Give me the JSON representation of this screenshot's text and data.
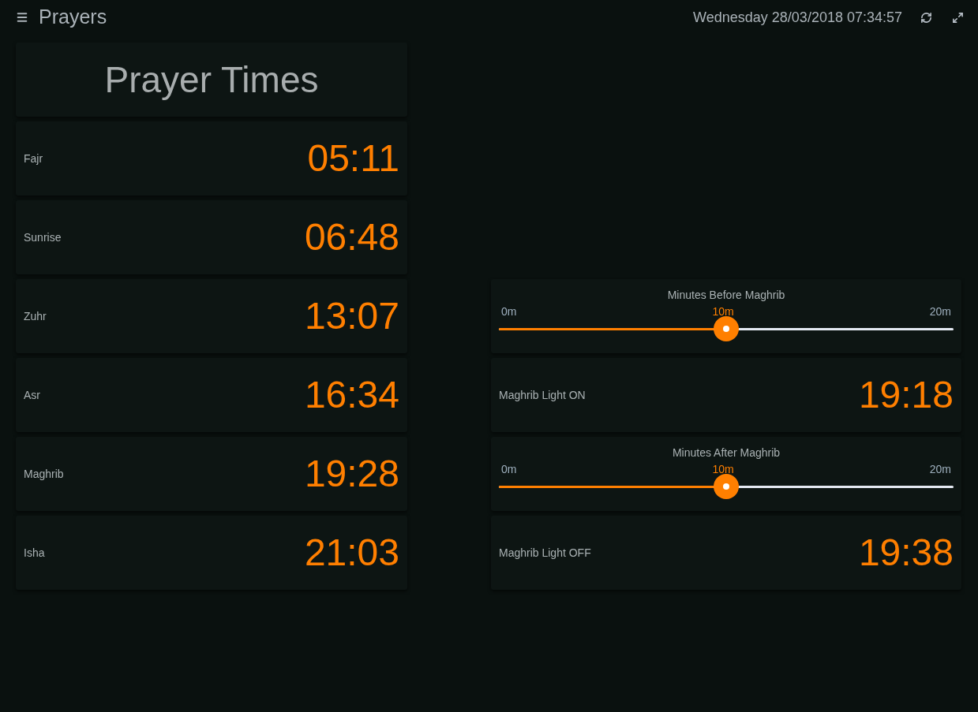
{
  "header": {
    "title": "Prayers",
    "datetime": "Wednesday 28/03/2018 07:34:57"
  },
  "title_card": {
    "title": "Prayer Times"
  },
  "prayers": [
    {
      "name": "Fajr",
      "time": "05:11"
    },
    {
      "name": "Sunrise",
      "time": "06:48"
    },
    {
      "name": "Zuhr",
      "time": "13:07"
    },
    {
      "name": "Asr",
      "time": "16:34"
    },
    {
      "name": "Maghrib",
      "time": "19:28"
    },
    {
      "name": "Isha",
      "time": "21:03"
    }
  ],
  "controls": [
    {
      "kind": "slider",
      "label": "Minutes Before Maghrib",
      "min_label": "0m",
      "value_label": "10m",
      "max_label": "20m",
      "level": 0.5
    },
    {
      "kind": "time",
      "label": "Maghrib Light ON",
      "time": "19:18"
    },
    {
      "kind": "slider",
      "label": "Minutes After Maghrib",
      "min_label": "0m",
      "value_label": "10m",
      "max_label": "20m",
      "level": 0.5
    },
    {
      "kind": "time",
      "label": "Maghrib Light OFF",
      "time": "19:38"
    }
  ]
}
